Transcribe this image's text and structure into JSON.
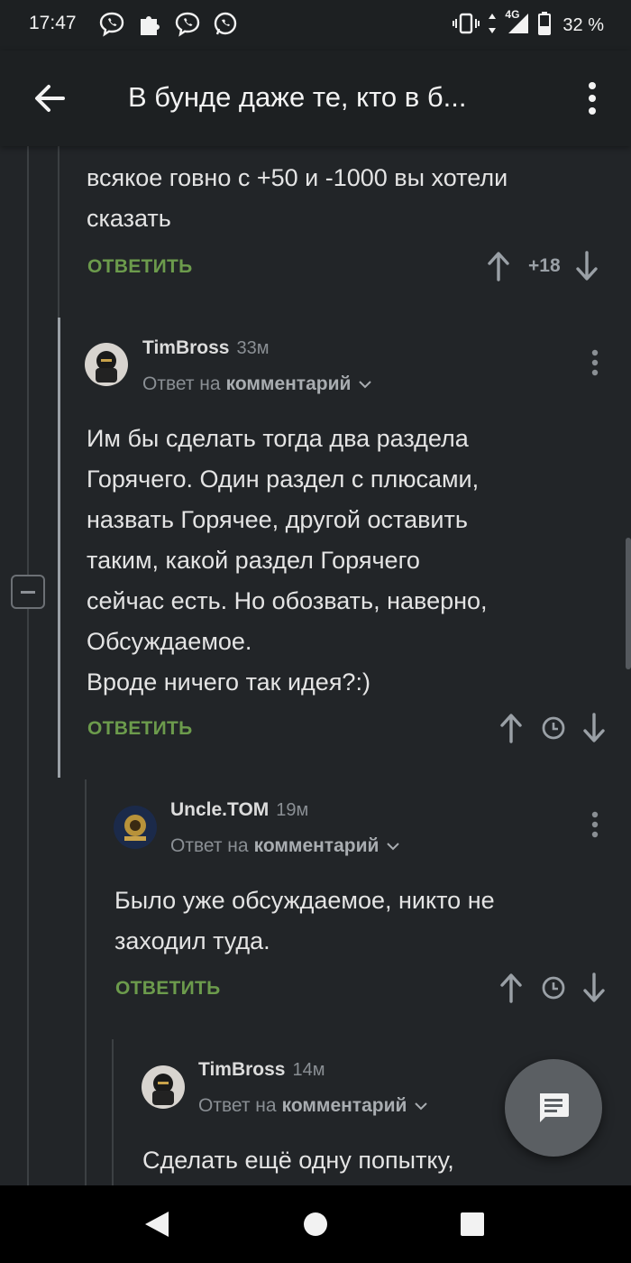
{
  "status_bar": {
    "time": "17:47",
    "battery": "32 %",
    "network": "4G",
    "app_icons": [
      "viber-icon",
      "puzzle-icon",
      "viber-icon",
      "whatsapp-icon"
    ]
  },
  "app_bar": {
    "title": "В бунде даже те, кто в б..."
  },
  "comments": [
    {
      "text_lines": [
        "всякое говно с +50 и -1000 вы хотели",
        "сказать"
      ],
      "reply_label": "ОТВЕТИТЬ",
      "rating": "+18"
    },
    {
      "author": "TimBross",
      "time": "33м",
      "reply_prefix": "Ответ на",
      "reply_target": "комментарий",
      "text_lines": [
        "Им бы сделать тогда два раздела",
        "Горячего. Один раздел с плюсами,",
        "назвать Горячее, другой оставить",
        "таким, какой раздел Горячего",
        "сейчас есть. Но обозвать, наверно,",
        "Обсуждаемое.",
        "Вроде ничего так идея?:)"
      ],
      "reply_label": "ОТВЕТИТЬ"
    },
    {
      "author": "Uncle.TOM",
      "time": "19м",
      "reply_prefix": "Ответ на",
      "reply_target": "комментарий",
      "text_lines": [
        "Было уже обсуждаемое, никто не",
        "заходил туда."
      ],
      "reply_label": "ОТВЕТИТЬ"
    },
    {
      "author": "TimBross",
      "time": "14м",
      "reply_prefix": "Ответ на",
      "reply_target": "комментарий",
      "text_lines": [
        "Сделать ещё одну попытку,"
      ]
    }
  ],
  "colors": {
    "background": "#222528",
    "reply_green": "#6c9b4c",
    "fab": "#5b5f63"
  }
}
